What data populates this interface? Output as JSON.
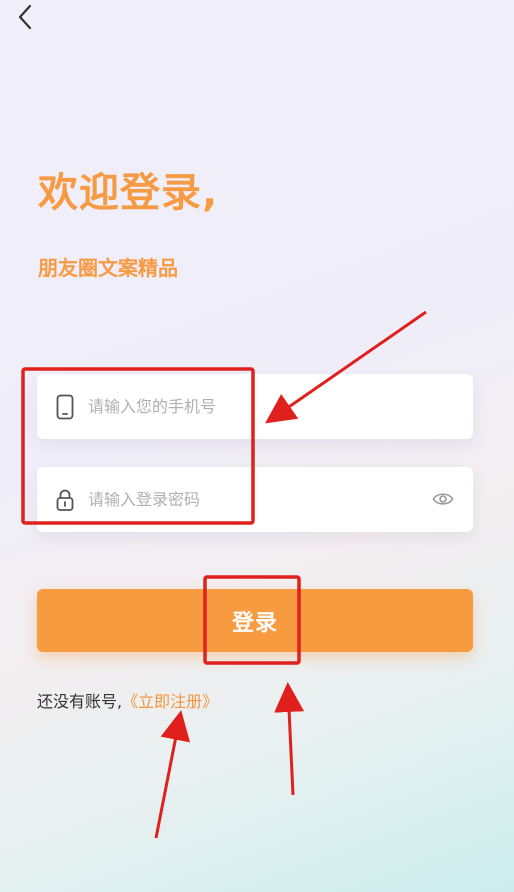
{
  "header": {
    "back_icon": "chevron-left-icon"
  },
  "welcome": {
    "title": "欢迎登录,",
    "subtitle": "朋友圈文案精品"
  },
  "form": {
    "phone": {
      "icon": "phone-icon",
      "placeholder": "请输入您的手机号",
      "value": ""
    },
    "password": {
      "icon": "lock-icon",
      "placeholder": "请输入登录密码",
      "value": "",
      "toggle_icon": "eye-icon"
    },
    "login_label": "登录"
  },
  "register": {
    "prompt": "还没有账号,",
    "link": "《立即注册》"
  },
  "colors": {
    "accent": "#f89a3f",
    "annotation": "#e0201c"
  }
}
